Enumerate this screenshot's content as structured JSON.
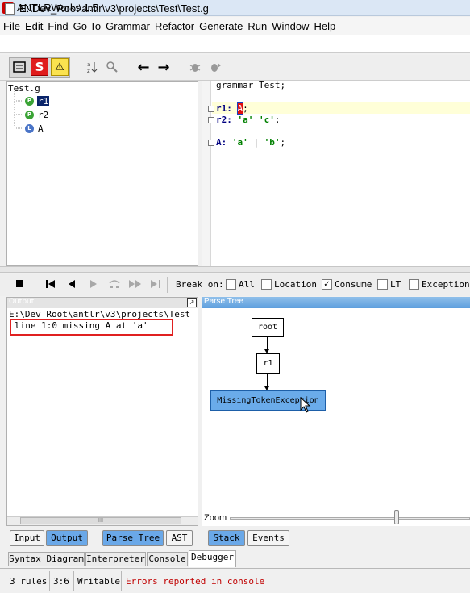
{
  "window": {
    "title": "ANTLRWorks 1.5"
  },
  "menu": [
    "File",
    "Edit",
    "Find",
    "Go To",
    "Grammar",
    "Refactor",
    "Generate",
    "Run",
    "Window",
    "Help"
  ],
  "document": {
    "path": "E:\\Dev_Root\\antlr\\v3\\projects\\Test\\Test.g"
  },
  "toolbar": {
    "s_label": "S",
    "warn_glyph": "⚠",
    "back_glyph": "←",
    "forward_glyph": "→"
  },
  "tree": {
    "root": "Test.g",
    "items": [
      {
        "badge": "P",
        "name": "r1",
        "color": "#3aa335"
      },
      {
        "badge": "P",
        "name": "r2",
        "color": "#3aa335"
      },
      {
        "badge": "L",
        "name": "A",
        "color": "#4a74c7"
      }
    ]
  },
  "editor": {
    "line1": "grammar Test;",
    "r1_name": "r1:",
    "r1_body_token": "A",
    "r1_body_end": ";",
    "r2_name": "r2:",
    "r2_tok1": "'a'",
    "r2_tok2": "'c'",
    "r2_end": ";",
    "a_name": "A:",
    "a_tok1": "'a'",
    "a_sep": "|",
    "a_tok2": "'b'",
    "a_end": ";"
  },
  "debugger": {
    "break_on_label": "Break on:",
    "checks": [
      {
        "label": "All",
        "checked": false
      },
      {
        "label": "Location",
        "checked": false
      },
      {
        "label": "Consume",
        "checked": true
      },
      {
        "label": "LT",
        "checked": false
      },
      {
        "label": "Exception",
        "checked": false
      }
    ],
    "tick": "✓"
  },
  "output": {
    "header": "Output",
    "path": "E:\\Dev_Root\\antlr\\v3\\projects\\Test",
    "error": "line 1:0 missing A at 'a'",
    "expand_glyph": "↗",
    "scroll_grip": "III"
  },
  "parse_tree": {
    "header": "Parse Tree",
    "nodes": {
      "root": "root",
      "r1": "r1",
      "error": "MissingTokenException"
    },
    "zoom_label": "Zoom"
  },
  "subtabs_left": {
    "input": "Input",
    "output": "Output"
  },
  "subtabs_mid": {
    "parse_tree": "Parse Tree",
    "ast": "AST"
  },
  "subtabs_right": {
    "stack": "Stack",
    "events": "Events"
  },
  "bottom_tabs": [
    "Syntax Diagram",
    "Interpreter",
    "Console",
    "Debugger"
  ],
  "status": {
    "rules": "3 rules",
    "position": "3:6",
    "mode": "Writable",
    "message": "Errors reported in console",
    "message_color": "#c00000"
  }
}
